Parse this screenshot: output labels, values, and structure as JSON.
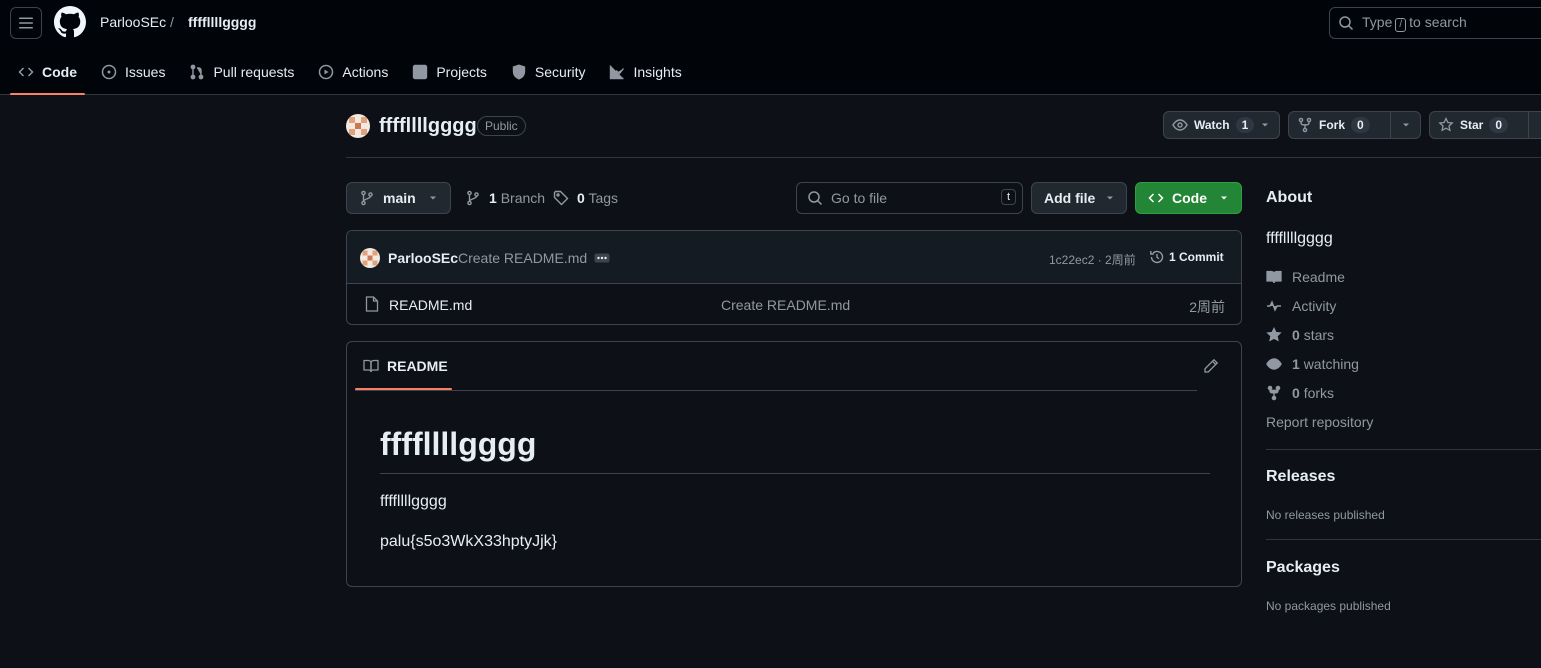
{
  "header": {
    "owner": "ParlooSEc",
    "separator": "/",
    "repo": "ffffllllgggg",
    "search_prefix": "Type",
    "search_key": "/",
    "search_suffix": "to search"
  },
  "tabs": [
    {
      "label": "Code",
      "icon": "code-icon",
      "active": true
    },
    {
      "label": "Issues",
      "icon": "issue-icon"
    },
    {
      "label": "Pull requests",
      "icon": "pull-request-icon"
    },
    {
      "label": "Actions",
      "icon": "play-icon"
    },
    {
      "label": "Projects",
      "icon": "table-icon"
    },
    {
      "label": "Security",
      "icon": "shield-icon"
    },
    {
      "label": "Insights",
      "icon": "graph-icon"
    }
  ],
  "repo_header": {
    "title": "ffffllllgggg",
    "visibility": "Public",
    "watch_label": "Watch",
    "watch_count": "1",
    "fork_label": "Fork",
    "fork_count": "0",
    "star_label": "Star",
    "star_count": "0"
  },
  "toolbar": {
    "branch": "main",
    "branch_count": "1",
    "branch_word": "Branch",
    "tag_count": "0",
    "tag_word": "Tags",
    "goto_placeholder": "Go to file",
    "goto_key": "t",
    "add_file": "Add file",
    "code": "Code"
  },
  "commit": {
    "author": "ParlooSEc",
    "message": "Create README.md",
    "hash_time": "1c22ec2 · 2周前",
    "count_label": "1 Commit"
  },
  "files": [
    {
      "name": "README.md",
      "message": "Create README.md",
      "date": "2周前"
    }
  ],
  "readme": {
    "tab_label": "README",
    "heading": "ffffllllgggg",
    "para1": "ffffllllgggg",
    "para2": "palu{s5o3WkX33hptyJjk}"
  },
  "about": {
    "heading": "About",
    "description": "ffffllllgggg",
    "readme": "Readme",
    "activity": "Activity",
    "stars_count": "0",
    "stars_word": "stars",
    "watching_count": "1",
    "watching_word": "watching",
    "forks_count": "0",
    "forks_word": "forks",
    "report": "Report repository"
  },
  "releases": {
    "heading": "Releases",
    "note": "No releases published"
  },
  "packages": {
    "heading": "Packages",
    "note": "No packages published"
  },
  "colors": {
    "accent": "#f78166",
    "green": "#238636",
    "bg": "#0d1117"
  }
}
